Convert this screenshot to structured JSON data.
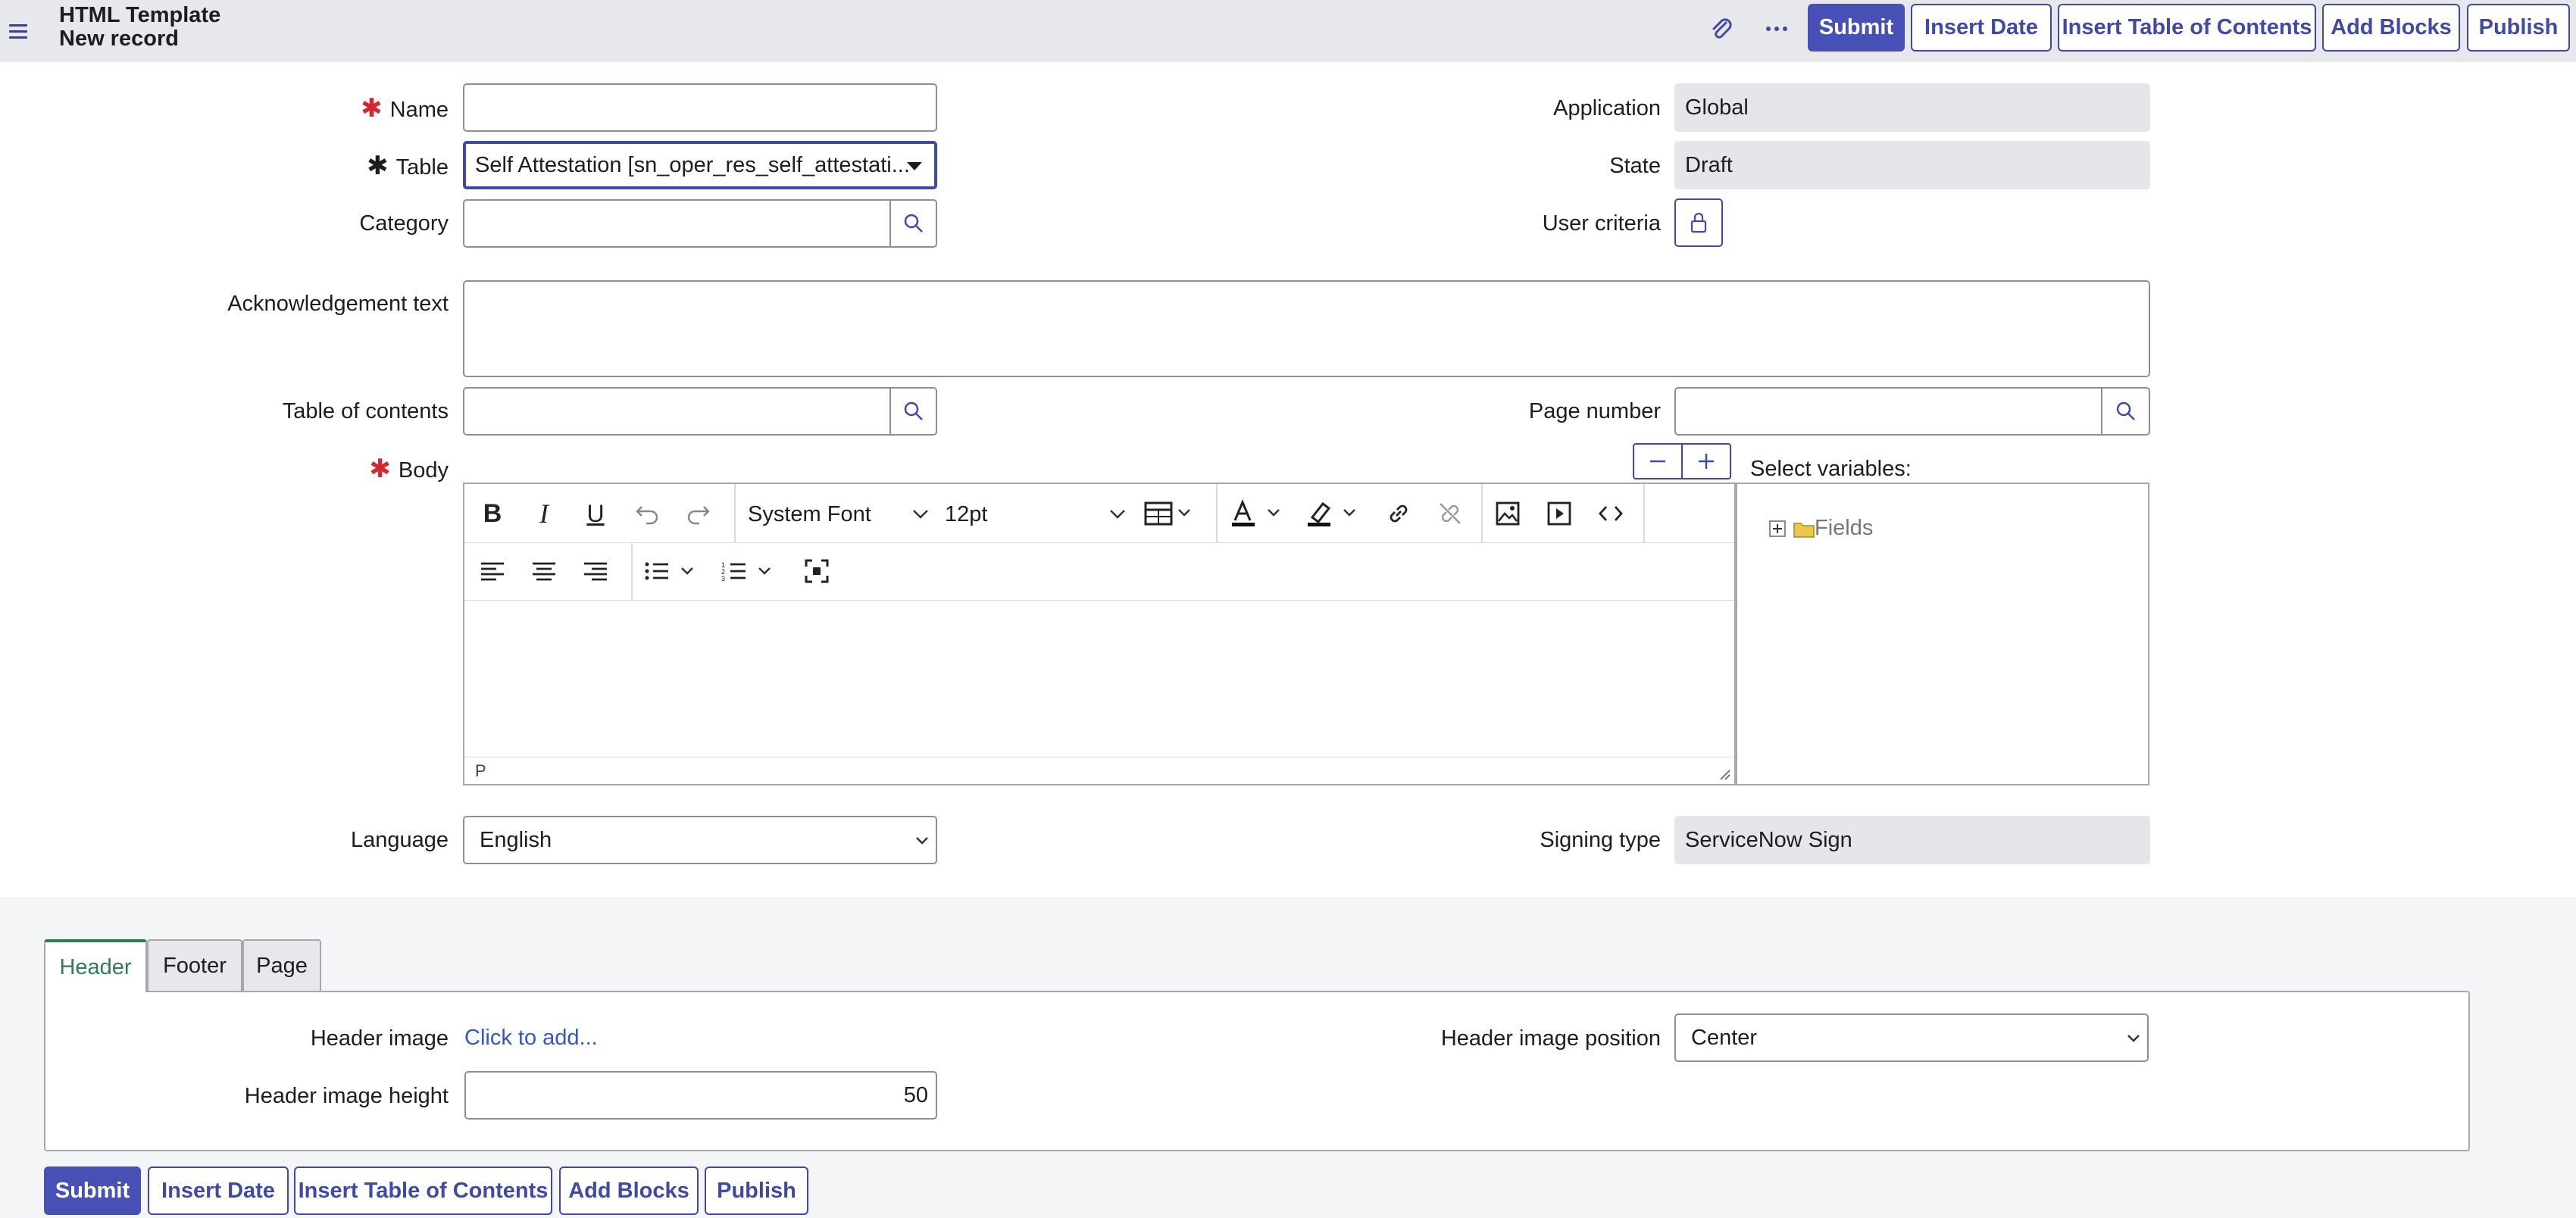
{
  "header": {
    "title": "HTML Template",
    "subtitle": "New record",
    "buttons": {
      "submit": "Submit",
      "insert_date": "Insert Date",
      "insert_toc": "Insert Table of Contents",
      "add_blocks": "Add Blocks",
      "publish": "Publish"
    }
  },
  "form": {
    "name_label": "Name",
    "name_value": "",
    "table_label": "Table",
    "table_value": "Self Attestation [sn_oper_res_self_attestati...",
    "category_label": "Category",
    "category_value": "",
    "application_label": "Application",
    "application_value": "Global",
    "state_label": "State",
    "state_value": "Draft",
    "user_criteria_label": "User criteria",
    "ack_label": "Acknowledgement text",
    "ack_value": "",
    "toc_label": "Table of contents",
    "toc_value": "",
    "page_number_label": "Page number",
    "page_number_value": "",
    "body_label": "Body",
    "language_label": "Language",
    "language_value": "English",
    "signing_label": "Signing type",
    "signing_value": "ServiceNow Sign"
  },
  "editor": {
    "font_family": "System Font",
    "font_size": "12pt",
    "status_path": "P",
    "icons": [
      "bold-icon",
      "italic-icon",
      "underline-icon",
      "undo-icon",
      "redo-icon",
      "table-icon",
      "text-color-icon",
      "highlight-icon",
      "link-icon",
      "unlink-icon",
      "image-icon",
      "media-icon",
      "code-icon",
      "align-left-icon",
      "align-center-icon",
      "align-right-icon",
      "bullet-list-icon",
      "numbered-list-icon",
      "fullscreen-icon"
    ]
  },
  "variables": {
    "title": "Select variables:",
    "tree_root": "Fields"
  },
  "tabs": {
    "items": [
      "Header",
      "Footer",
      "Page"
    ],
    "active": "Header"
  },
  "header_tab": {
    "image_label": "Header image",
    "image_link": "Click to add...",
    "image_position_label": "Header image position",
    "image_position_value": "Center",
    "image_height_label": "Header image height",
    "image_height_value": "50"
  },
  "footer_buttons": {
    "submit": "Submit",
    "insert_date": "Insert Date",
    "insert_toc": "Insert Table of Contents",
    "add_blocks": "Add Blocks",
    "publish": "Publish"
  },
  "colors": {
    "primary": "#4750b5",
    "required": "#d6262e",
    "active_tab": "#2e7d54",
    "readonly_bg": "#e5e6e9"
  }
}
